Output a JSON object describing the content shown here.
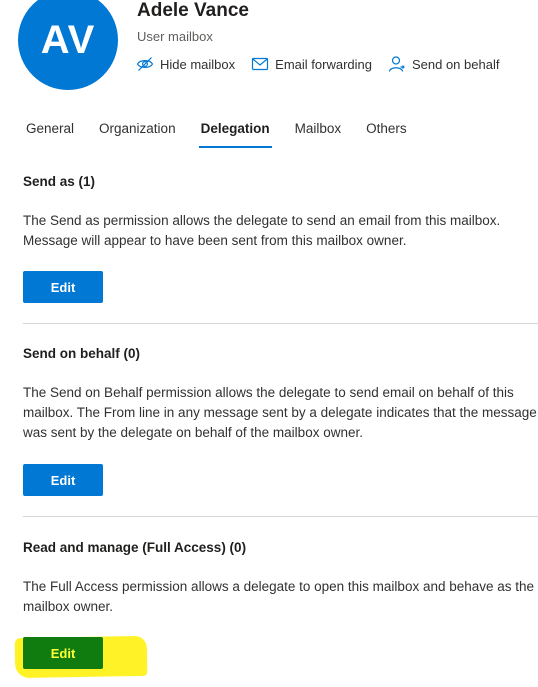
{
  "header": {
    "initials": "AV",
    "name": "Adele Vance",
    "type": "User mailbox",
    "avatar_color": "#0078d4",
    "actions": [
      {
        "label": "Hide mailbox",
        "icon": "eye-hide-icon"
      },
      {
        "label": "Email forwarding",
        "icon": "envelope-icon"
      },
      {
        "label": "Send on behalf",
        "icon": "person-icon"
      }
    ]
  },
  "tabs": [
    {
      "label": "General",
      "active": false
    },
    {
      "label": "Organization",
      "active": false
    },
    {
      "label": "Delegation",
      "active": true
    },
    {
      "label": "Mailbox",
      "active": false
    },
    {
      "label": "Others",
      "active": false
    }
  ],
  "sections": [
    {
      "title": "Send as (1)",
      "description": "The Send as permission allows the delegate to send an email from this mailbox. Message will appear to have been sent from this mailbox owner.",
      "button_label": "Edit"
    },
    {
      "title": "Send on behalf (0)",
      "description": "The Send on Behalf permission allows the delegate to send email on behalf of this mailbox. The From line in any message sent by a delegate indicates that the message was sent by the delegate on behalf of the mailbox owner.",
      "button_label": "Edit"
    },
    {
      "title": "Read and manage (Full Access) (0)",
      "description": "The Full Access permission allows a delegate to open this mailbox and behave as the mailbox owner.",
      "button_label": "Edit"
    }
  ],
  "colors": {
    "accent": "#0078d4",
    "highlight": "#fff000",
    "highlighted_button": "#107c10"
  }
}
